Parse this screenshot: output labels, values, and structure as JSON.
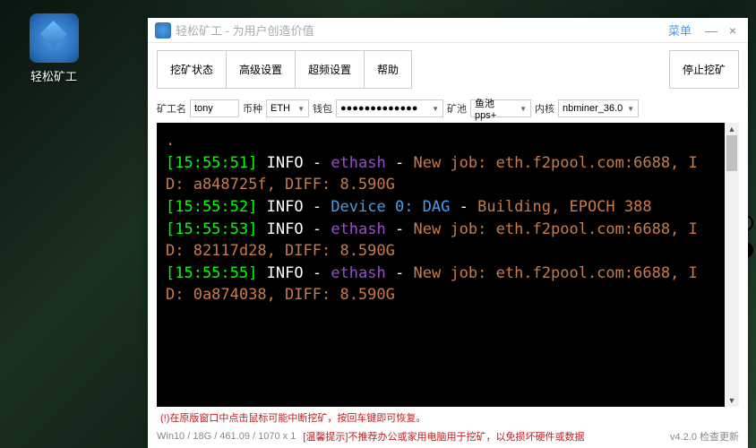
{
  "desktop": {
    "icon_label": "轻松矿工"
  },
  "titlebar": {
    "title": "轻松矿工 - 为用户创造价值",
    "menu_label": "菜单"
  },
  "tabs": {
    "mining_status": "挖矿状态",
    "advanced": "高级设置",
    "overclock": "超频设置",
    "help": "帮助",
    "stop_mining": "停止挖矿"
  },
  "config": {
    "miner_label": "矿工名",
    "miner_value": "tony",
    "coin_label": "币种",
    "coin_value": "ETH",
    "wallet_label": "钱包",
    "wallet_value": "●●●●●●●●●●●●●",
    "pool_label": "矿池",
    "pool_value": "鱼池pps+",
    "kernel_label": "内核",
    "kernel_value": "nbminer_36.0"
  },
  "log_lines": [
    {
      "ts": "[15:55:51]",
      "level": "INFO",
      "tag": "ethash",
      "tagClass": "ethash",
      "msg": "New job: eth.f2pool.com:6688, ID: a848725f, DIFF: 8.590G"
    },
    {
      "ts": "[15:55:52]",
      "level": "INFO",
      "tag": "Device 0: DAG",
      "tagClass": "device",
      "msg": "Building, EPOCH 388"
    },
    {
      "ts": "[15:55:53]",
      "level": "INFO",
      "tag": "ethash",
      "tagClass": "ethash",
      "msg": "New job: eth.f2pool.com:6688, ID: 82117d28, DIFF: 8.590G"
    },
    {
      "ts": "[15:55:55]",
      "level": "INFO",
      "tag": "ethash",
      "tagClass": "ethash",
      "msg": "New job: eth.f2pool.com:6688, ID: 0a874038, DIFF: 8.590G"
    }
  ],
  "warning_inline": "(!)在原版窗口中点击鼠标可能中断挖矿，按回车键即可恢复。",
  "status": {
    "system": "Win10 / 18G / 461.09 / 1070 x 1",
    "tip": "[温馨提示]不推荐办公或家用电脑用于挖矿，以免损坏硬件或数据",
    "version": "v4.2.0 检查更新"
  }
}
